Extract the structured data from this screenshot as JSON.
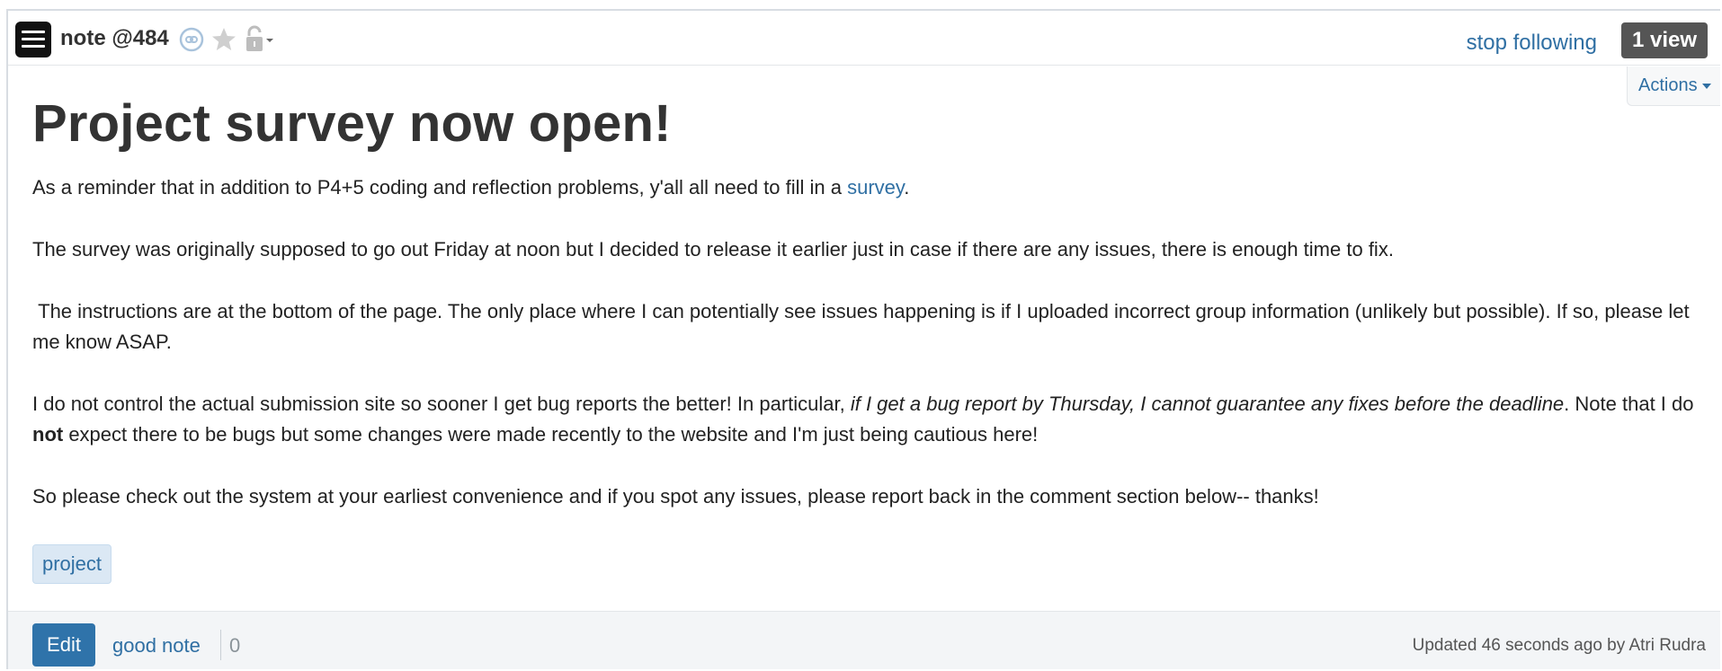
{
  "header": {
    "note_id": "note @484",
    "stop_following": "stop following",
    "view_count": "1 view",
    "actions_label": "Actions"
  },
  "icons": {
    "menu": "hamburger-menu-icon",
    "link": "link-icon",
    "star": "star-icon",
    "lock": "lock-icon"
  },
  "post": {
    "title": "Project survey now open!",
    "p1_before": "As a reminder that in addition to P4+5 coding and reflection problems, y'all all need to fill in a ",
    "p1_link": "survey",
    "p1_after": ".",
    "p2": "The survey was originally supposed to go out Friday at noon but I decided to release it earlier just in case if there are any issues, there is enough time to fix.",
    "p3": " The instructions are at the bottom of the page. The only place where I can potentially see issues happening is if I uploaded incorrect group information (unlikely but possible). If so, please let me know ASAP.",
    "p4_before": "I do not control the actual submission site so sooner I get bug reports the better! In particular, ",
    "p4_italic": "if I get a bug report by Thursday, I cannot guarantee any fixes before the deadline",
    "p4_mid": ". Note that I do ",
    "p4_bold": "not",
    "p4_after": " expect there to be bugs but some changes were made recently to the website and I'm just being cautious here!",
    "p5": "So please check out the system at your earliest convenience and if you spot any issues, please report back in the comment section below-- thanks!",
    "tag": "project"
  },
  "footer": {
    "edit_label": "Edit",
    "good_note_label": "good note",
    "good_note_count": "0",
    "updated_text": "Updated 46 seconds ago by Atri Rudra"
  },
  "colors": {
    "link": "#2f6fa3",
    "edit_button": "#2f73aa",
    "view_badge": "#555555",
    "tag_bg": "#dbe8f4"
  }
}
